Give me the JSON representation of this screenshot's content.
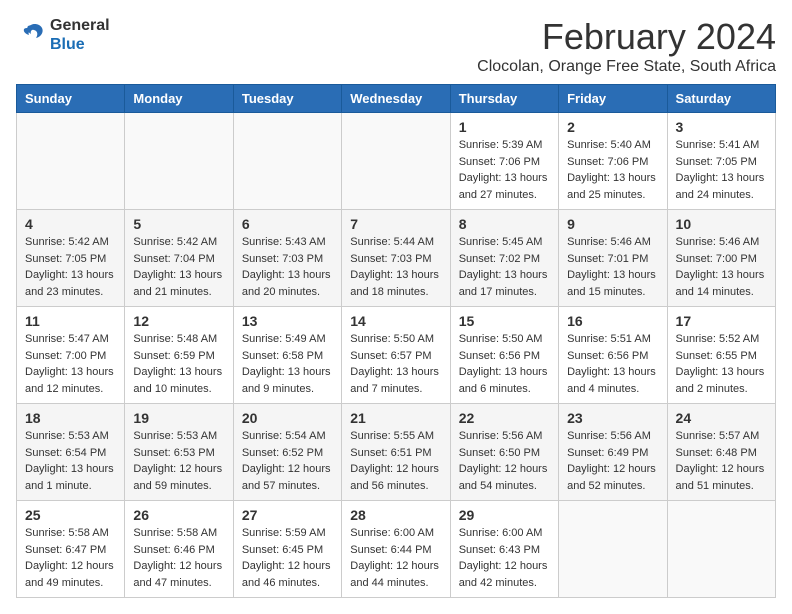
{
  "header": {
    "logo_general": "General",
    "logo_blue": "Blue",
    "month_title": "February 2024",
    "subtitle": "Clocolan, Orange Free State, South Africa"
  },
  "days_of_week": [
    "Sunday",
    "Monday",
    "Tuesday",
    "Wednesday",
    "Thursday",
    "Friday",
    "Saturday"
  ],
  "weeks": [
    [
      {
        "day": "",
        "info": ""
      },
      {
        "day": "",
        "info": ""
      },
      {
        "day": "",
        "info": ""
      },
      {
        "day": "",
        "info": ""
      },
      {
        "day": "1",
        "info": "Sunrise: 5:39 AM\nSunset: 7:06 PM\nDaylight: 13 hours\nand 27 minutes."
      },
      {
        "day": "2",
        "info": "Sunrise: 5:40 AM\nSunset: 7:06 PM\nDaylight: 13 hours\nand 25 minutes."
      },
      {
        "day": "3",
        "info": "Sunrise: 5:41 AM\nSunset: 7:05 PM\nDaylight: 13 hours\nand 24 minutes."
      }
    ],
    [
      {
        "day": "4",
        "info": "Sunrise: 5:42 AM\nSunset: 7:05 PM\nDaylight: 13 hours\nand 23 minutes."
      },
      {
        "day": "5",
        "info": "Sunrise: 5:42 AM\nSunset: 7:04 PM\nDaylight: 13 hours\nand 21 minutes."
      },
      {
        "day": "6",
        "info": "Sunrise: 5:43 AM\nSunset: 7:03 PM\nDaylight: 13 hours\nand 20 minutes."
      },
      {
        "day": "7",
        "info": "Sunrise: 5:44 AM\nSunset: 7:03 PM\nDaylight: 13 hours\nand 18 minutes."
      },
      {
        "day": "8",
        "info": "Sunrise: 5:45 AM\nSunset: 7:02 PM\nDaylight: 13 hours\nand 17 minutes."
      },
      {
        "day": "9",
        "info": "Sunrise: 5:46 AM\nSunset: 7:01 PM\nDaylight: 13 hours\nand 15 minutes."
      },
      {
        "day": "10",
        "info": "Sunrise: 5:46 AM\nSunset: 7:00 PM\nDaylight: 13 hours\nand 14 minutes."
      }
    ],
    [
      {
        "day": "11",
        "info": "Sunrise: 5:47 AM\nSunset: 7:00 PM\nDaylight: 13 hours\nand 12 minutes."
      },
      {
        "day": "12",
        "info": "Sunrise: 5:48 AM\nSunset: 6:59 PM\nDaylight: 13 hours\nand 10 minutes."
      },
      {
        "day": "13",
        "info": "Sunrise: 5:49 AM\nSunset: 6:58 PM\nDaylight: 13 hours\nand 9 minutes."
      },
      {
        "day": "14",
        "info": "Sunrise: 5:50 AM\nSunset: 6:57 PM\nDaylight: 13 hours\nand 7 minutes."
      },
      {
        "day": "15",
        "info": "Sunrise: 5:50 AM\nSunset: 6:56 PM\nDaylight: 13 hours\nand 6 minutes."
      },
      {
        "day": "16",
        "info": "Sunrise: 5:51 AM\nSunset: 6:56 PM\nDaylight: 13 hours\nand 4 minutes."
      },
      {
        "day": "17",
        "info": "Sunrise: 5:52 AM\nSunset: 6:55 PM\nDaylight: 13 hours\nand 2 minutes."
      }
    ],
    [
      {
        "day": "18",
        "info": "Sunrise: 5:53 AM\nSunset: 6:54 PM\nDaylight: 13 hours\nand 1 minute."
      },
      {
        "day": "19",
        "info": "Sunrise: 5:53 AM\nSunset: 6:53 PM\nDaylight: 12 hours\nand 59 minutes."
      },
      {
        "day": "20",
        "info": "Sunrise: 5:54 AM\nSunset: 6:52 PM\nDaylight: 12 hours\nand 57 minutes."
      },
      {
        "day": "21",
        "info": "Sunrise: 5:55 AM\nSunset: 6:51 PM\nDaylight: 12 hours\nand 56 minutes."
      },
      {
        "day": "22",
        "info": "Sunrise: 5:56 AM\nSunset: 6:50 PM\nDaylight: 12 hours\nand 54 minutes."
      },
      {
        "day": "23",
        "info": "Sunrise: 5:56 AM\nSunset: 6:49 PM\nDaylight: 12 hours\nand 52 minutes."
      },
      {
        "day": "24",
        "info": "Sunrise: 5:57 AM\nSunset: 6:48 PM\nDaylight: 12 hours\nand 51 minutes."
      }
    ],
    [
      {
        "day": "25",
        "info": "Sunrise: 5:58 AM\nSunset: 6:47 PM\nDaylight: 12 hours\nand 49 minutes."
      },
      {
        "day": "26",
        "info": "Sunrise: 5:58 AM\nSunset: 6:46 PM\nDaylight: 12 hours\nand 47 minutes."
      },
      {
        "day": "27",
        "info": "Sunrise: 5:59 AM\nSunset: 6:45 PM\nDaylight: 12 hours\nand 46 minutes."
      },
      {
        "day": "28",
        "info": "Sunrise: 6:00 AM\nSunset: 6:44 PM\nDaylight: 12 hours\nand 44 minutes."
      },
      {
        "day": "29",
        "info": "Sunrise: 6:00 AM\nSunset: 6:43 PM\nDaylight: 12 hours\nand 42 minutes."
      },
      {
        "day": "",
        "info": ""
      },
      {
        "day": "",
        "info": ""
      }
    ]
  ]
}
